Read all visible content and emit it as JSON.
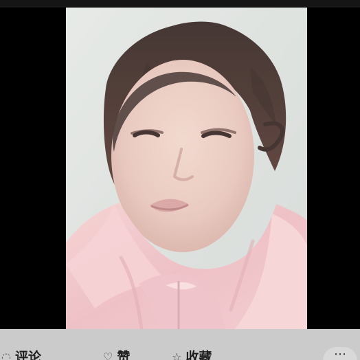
{
  "viewer": {
    "photo_alt": "selfie photo"
  },
  "bottom_bar": {
    "comment": {
      "label": "评论",
      "icon": "comment-icon"
    },
    "like": {
      "label": "赞",
      "icon": "like-icon"
    },
    "favorite": {
      "label": "收藏",
      "icon": "star-icon"
    },
    "more": {
      "label": "⋯",
      "icon": "more-icon"
    }
  },
  "colors": {
    "background": "#000000",
    "bottom_bar": "#cbcbcb",
    "photo_wall": "#d9dedb",
    "jacket_pink": "#f0c7c9"
  }
}
